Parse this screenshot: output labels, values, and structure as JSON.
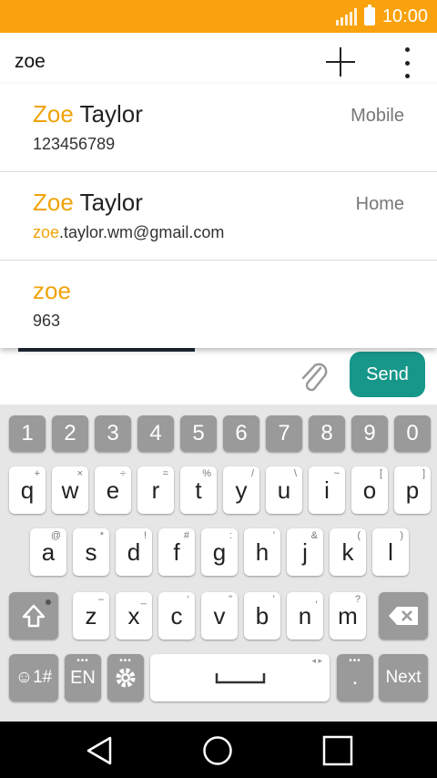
{
  "status_bar": {
    "time": "10:00",
    "color": "#f9a20d"
  },
  "recipient": {
    "query": "zoe",
    "add_icon": "plus-icon",
    "more_icon": "more-vert-icon"
  },
  "suggestions": [
    {
      "name_match": "Zoe",
      "name_rest": " Taylor",
      "type": "Mobile",
      "detail_match": "",
      "detail_rest": "123456789"
    },
    {
      "name_match": "Zoe",
      "name_rest": " Taylor",
      "type": "Home",
      "detail_match": "zoe",
      "detail_rest": ".taylor.wm@gmail.com"
    },
    {
      "name_match": "zoe",
      "name_rest": "",
      "type": "",
      "detail_match": "",
      "detail_rest": "963"
    }
  ],
  "compose": {
    "send_label": "Send",
    "attach_icon": "paperclip-icon",
    "send_color": "#17978a"
  },
  "keyboard": {
    "numbers": [
      "1",
      "2",
      "3",
      "4",
      "5",
      "6",
      "7",
      "8",
      "9",
      "0"
    ],
    "row1": [
      [
        "q",
        "+"
      ],
      [
        "w",
        "×"
      ],
      [
        "e",
        "÷"
      ],
      [
        "r",
        "="
      ],
      [
        "t",
        "%"
      ],
      [
        "y",
        "/"
      ],
      [
        "u",
        "\\"
      ],
      [
        "i",
        "~"
      ],
      [
        "o",
        "["
      ],
      [
        "p",
        "]"
      ]
    ],
    "row2": [
      [
        "a",
        "@"
      ],
      [
        "s",
        "*"
      ],
      [
        "d",
        "!"
      ],
      [
        "f",
        "#"
      ],
      [
        "g",
        ":"
      ],
      [
        "h",
        "'"
      ],
      [
        "j",
        "&"
      ],
      [
        "k",
        "("
      ],
      [
        "l",
        ")"
      ]
    ],
    "row3": [
      [
        "z",
        "–"
      ],
      [
        "x",
        "_"
      ],
      [
        "c",
        "‘"
      ],
      [
        "v",
        "\""
      ],
      [
        "b",
        "’"
      ],
      [
        "n",
        ","
      ],
      [
        "m",
        "?"
      ]
    ],
    "emoji_label": "☺1#",
    "lang_label": "EN",
    "period_label": ".",
    "next_label": "Next"
  },
  "nav_bar": {
    "back_icon": "back-icon",
    "home_icon": "home-icon",
    "recents_icon": "recents-icon"
  }
}
